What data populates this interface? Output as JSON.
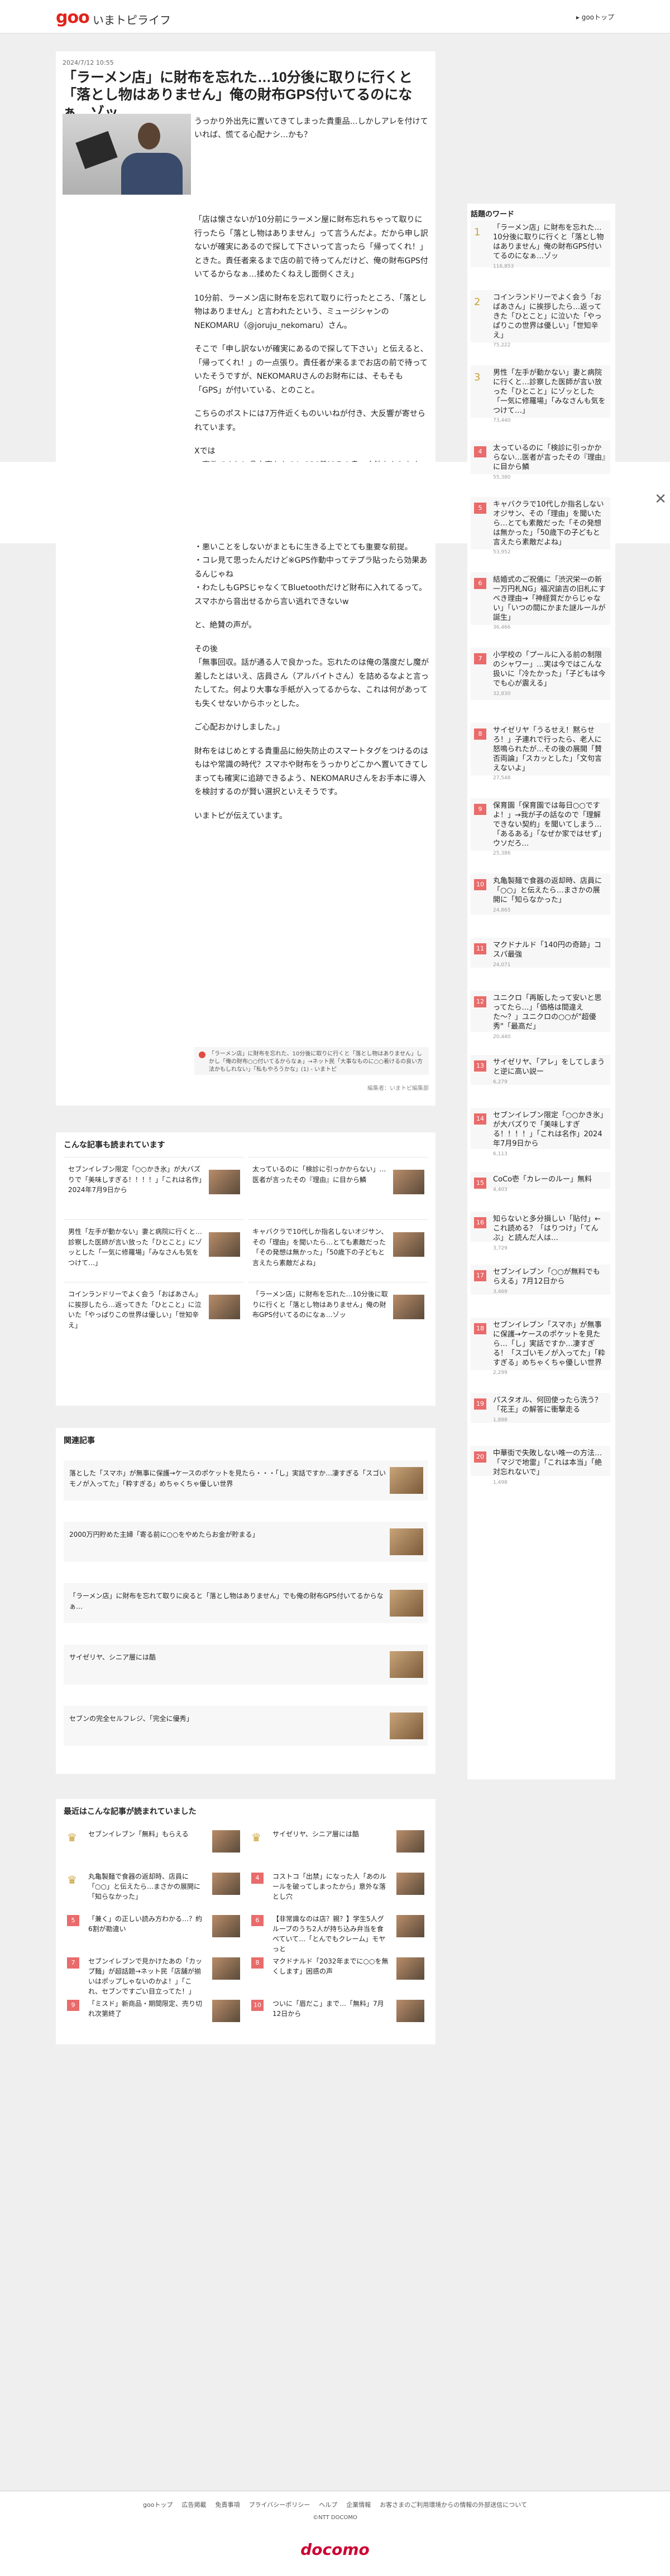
{
  "header": {
    "logo": "goo",
    "site_name": "いまトピライフ",
    "goo_top": "▸ gooトップ"
  },
  "article": {
    "date": "2024/7/12 10:55",
    "title": "「ラーメン店」に財布を忘れた…10分後に取りに行くと「落とし物はありません」俺の財布GPS付いてるのになぁ…ゾッ",
    "lead": "うっかり外出先に置いてきてしまった貴重品…しかしアレを付けていれば、慌てる心配ナシ…かも？",
    "body": [
      "「店は懐さないが10分前にラーメン屋に財布忘れちゃって取りに行ったら「落とし物はありません」って言うんだよ。だから申し訳ないが確実にあるので探して下さいって言ったら「帰ってくれ！」ときた。責任者来るまで店の前で待ってんだけど、俺の財布GPS付いてるからなぁ…揉めたくねえし面倒くさえ」",
      "10分前、ラーメン店に財布を忘れて取りに行ったところ、「落とし物はありません」と言われたという、ミュージシャンのNEKOMARU（@joruju_nekomaru）さん。",
      "そこで「申し訳ないが確実にあるので探して下さい」と伝えると、「帰ってくれ！」の一点張り。責任者が来るまでお店の前で待っていたそうですが、NEKOMARUさんのお財布には、そもそも「GPS」が付いている、とのこと。",
      "こちらのポストには7万件近くものいいねが付き、大反響が寄せられています。",
      "Xでは\n・事件ですね！＠大事なものにGPS着けるの良い方法かもしれない\n…\nかなかな\n・財布にGPS付ける(ﾟ∀ﾟ)私もやろうかな\n・俺も財布にエアタグ入れてる（前に落としたから）\n・悪いことをしないがまともに生きる上でとても重要な前提。\n・コレ見て思ったんだけど※GPS作動中ってテプラ貼ったら効果あるんじゃね\n・わたしもGPSじゃなくてBluetoothだけど財布に入れてるって。スマホから音出せるから言い逃れできないw",
      "と、絶賛の声が。",
      "その後\n「無事回収。話が通る人で良かった。忘れたのは俺の落度だし魔が差したとはいえ、店員さん（アルバイトさん）を詰めるなよと言ったしてた。何より大事な手紙が入ってるからな、これは何があっても失くせないからホッとした。",
      "ご心配おかけしました。」",
      "財布をはじめとする貴重品に紛失防止のスマートタグをつけるのはもはや常識の時代？スマホや財布をうっかりどこかへ置いてきてしまっても確実に追跡できるよう、NEKOMARUさんをお手本に導入を検討するのが賢い選択といえそうです。",
      "いまトピが伝えています。"
    ],
    "quote": "「ラーメン店」に財布を忘れた、10分後に取りに行くと「落とし物はありません」しかし「俺の財布○○付いてるからなぁ」→ネット民「大事なものに○○着けるの良い方法かもしれない」「私もやろうかな」(1) - いまトピ",
    "editor": "編集者：いまトピ編集部"
  },
  "sidebar": {
    "title": "話題のワード",
    "items": [
      {
        "rank": "1",
        "title": "「ラーメン店」に財布を忘れた…10分後に取りに行くと「落とし物はありません」俺の財布GPS付いてるのになぁ…ゾッ",
        "count": "116,853"
      },
      {
        "rank": "2",
        "title": "コインランドリーでよく会う「おばあさん」に挨拶したら…返ってきた「ひとこと」に泣いた「やっぱりこの世界は優しい」「世知辛え」",
        "count": "75,222"
      },
      {
        "rank": "3",
        "title": "男性「左手が動かない」妻と病院に行くと…診察した医師が言い放った「ひとこと」にゾッとした「一気に修羅場」「みなさんも気をつけて…」",
        "count": "73,440"
      },
      {
        "rank": "4",
        "title": "太っているのに「検診に引っかからない…医者が言ったその『理由』に目から鱗",
        "count": "55,380"
      },
      {
        "rank": "5",
        "title": "キャバクラで10代しか指名しないオジサン、その「理由」を聞いたら…とても素敵だった「その発想は無かった」「50歳下の子どもと言えたら素敵だよね」",
        "count": "53,952"
      },
      {
        "rank": "6",
        "title": "結婚式のご祝儀に「渋沢栄一の新一万円札NG」福沢諭吉の旧札にすべき理由→「神経質だからじゃない」「いつの間にかまた謎ルールが誕生」",
        "count": "36,466"
      },
      {
        "rank": "7",
        "title": "小学校の「プールに入る前の制限のシャワー」…実は今ではこんな扱いに「冷たかった」「子どもは今でも心が震える」",
        "count": "32,830"
      },
      {
        "rank": "8",
        "title": "サイゼリヤ「うるせえ！黙らせろ！」子連れで行ったら、老人に怒鳴られたが…その後の展開「賛否両論」「スカッとした」「文句言えないよ」",
        "count": "27,548"
      },
      {
        "rank": "9",
        "title": "保育園「保育園では毎日○○ですよ！」→我が子の話なので「理解できない契約」を聞いてしまう…「あるある」「なぜか家ではせず」ウソだろ…",
        "count": "25,386"
      },
      {
        "rank": "10",
        "title": "丸亀製麺で食器の返却時、店員に「○○」と伝えたら…まさかの展開に「知らなかった」",
        "count": "24,865"
      },
      {
        "rank": "11",
        "title": "マクドナルド「140円の奇跡」コスパ最強",
        "count": "24,071"
      },
      {
        "rank": "12",
        "title": "ユニクロ「再販したって安いと思ってたら…」「価格は間違えた〜？」ユニクロの○○が\"超優秀\"「最高だ」",
        "count": "20,440"
      },
      {
        "rank": "13",
        "title": "サイゼリヤ、「アレ」をしてしまうと逆に高い説ー",
        "count": "6,279"
      },
      {
        "rank": "14",
        "title": "セブンイレブン限定「○○かき氷」が大バズりで「美味しすぎる！！！！」「これは名作」2024年7月9日から",
        "count": "6,113"
      },
      {
        "rank": "15",
        "title": "CoCo壱「カレーのルー」無料",
        "count": "4,403"
      },
      {
        "rank": "16",
        "title": "知らないと多分損しい「貼付」←これ読める？「はりつけ」「てんぶ」と読んだ人は…",
        "count": "3,729"
      },
      {
        "rank": "17",
        "title": "セブンイレブン「○○が無料でもらえる」7月12日から",
        "count": "3,469"
      },
      {
        "rank": "18",
        "title": "セブンイレブン「スマホ」が無事に保護→ケースのポケットを見たら…「し」実話ですか…凄すぎる！「スゴいモノが入ってた」「粋すぎる」めちゃくちゃ優しい世界",
        "count": "2,299"
      },
      {
        "rank": "19",
        "title": "パスタオル、何回使ったら洗う？「花王」の解答に衝撃走る",
        "count": "1,888"
      },
      {
        "rank": "20",
        "title": "中華街で失敗しない唯一の方法…「マジで地雷」「これは本当」「絶対忘れないで」",
        "count": "1,498"
      }
    ]
  },
  "also_read": {
    "title": "こんな記事も読まれています",
    "items": [
      "セブンイレブン限定「○○かき氷」が大バズりで「美味しすぎる！！！！」「これは名作」2024年7月9日から",
      "太っているのに「検診に引っかからない」…医者が言ったその『理由』に目から鱗",
      "男性「左手が動かない」妻と病院に行くと…診察した医師が言い放った「ひとこと」にゾッとした「一気に修羅場」「みなさんも気をつけて…」",
      "キャバクラで10代しか指名しないオジサン、その「理由」を聞いたら…とても素敵だった「その発想は無かった」「50歳下の子どもと言えたら素敵だよね」",
      "コインランドリーでよく会う「おばあさん」に挨拶したら…返ってきた「ひとこと」に泣いた「やっぱりこの世界は優しい」「世知辛え」",
      "「ラーメン店」に財布を忘れた…10分後に取りに行くと「落とし物はありません」俺の財布GPS付いてるのになぁ…ゾッ"
    ]
  },
  "related": {
    "title": "関連記事",
    "items": [
      "落とした「スマホ」が無事に保護→ケースのポケットを見たら・・・「し」実話ですか…凄すぎる「スゴいモノが入ってた」「粋すぎる」めちゃくちゃ優しい世界",
      "2000万円貯めた主婦「寄る前に○○をやめたらお金が貯まる」",
      "「ラーメン店」に財布を忘れて取りに戻ると「落とし物はありません」でも俺の財布GPS付いてるからなぁ…",
      "サイゼリヤ、シニア層には酷",
      "セブンの完全セルフレジ、「完全に優秀」"
    ]
  },
  "recent": {
    "title": "最近はこんな記事が読まれていました",
    "items": [
      {
        "rank": "1",
        "title": "セブンイレブン「無料」もらえる"
      },
      {
        "rank": "2",
        "title": "サイゼリヤ、シニア層には酷"
      },
      {
        "rank": "3",
        "title": "丸亀製麺で食器の返却時、店員に「○○」と伝えたら…まさかの展開に「知らなかった」"
      },
      {
        "rank": "4",
        "title": "コストコ「出禁」になった人「あのルールを破ってしまったから」意外な落とし穴"
      },
      {
        "rank": "5",
        "title": "「兼く」の正しい読み方わかる…？約6割が勘違い"
      },
      {
        "rank": "6",
        "title": "【非常識なのは店？親？】学生5人グループのうち2人が持ち込み弁当を食べていて…「とんでもクレーム」モヤっと"
      },
      {
        "rank": "7",
        "title": "セブンイレブンで見かけたあの「カップ麺」が超話題→ネット民「店舗が揃いはポップしゃないのかよ！」「これ、セブンですごい目立ってた！」"
      },
      {
        "rank": "8",
        "title": "マクドナルド「2032年までに○○を無くします」困惑の声"
      },
      {
        "rank": "9",
        "title": "「ミスド」新商品・期間限定、売り切れ次第終了"
      },
      {
        "rank": "10",
        "title": "ついに「眉だこ」まで…「無料」7月12日から"
      }
    ]
  },
  "footer": {
    "links": [
      "gooトップ",
      "広告掲載",
      "免責事項",
      "プライバシーポリシー",
      "ヘルプ",
      "企業情報",
      "お客さまのご利用環境からの情報の外部送信について"
    ],
    "copyright": "©NTT DOCOMO",
    "brand": "docomo"
  },
  "ad": {
    "close": "✕"
  }
}
